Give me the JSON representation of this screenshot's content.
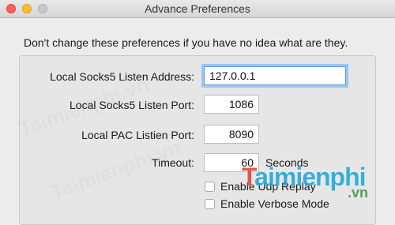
{
  "window": {
    "title": "Advance Preferences"
  },
  "warning": "Don't change these preferences if you have no idea what are they.",
  "fields": {
    "socks5_address": {
      "label": "Local Socks5 Listen Address:",
      "value": "127.0.0.1"
    },
    "socks5_port": {
      "label": "Local Socks5 Listen Port:",
      "value": "1086"
    },
    "pac_port": {
      "label": "Local PAC Listien Port:",
      "value": "8090"
    },
    "timeout": {
      "label": "Timeout:",
      "value": "60",
      "unit": "Seconds"
    }
  },
  "checkboxes": {
    "udp_replay": {
      "label": "Enable Udp Replay",
      "checked": false
    },
    "verbose_mode": {
      "label": "Enable Verbose Mode",
      "checked": false
    }
  },
  "watermark": {
    "logo_prefix": "T",
    "logo_rest": "aimienphi",
    "suffix": ".vn",
    "faint": "Taimienphi.vn"
  }
}
